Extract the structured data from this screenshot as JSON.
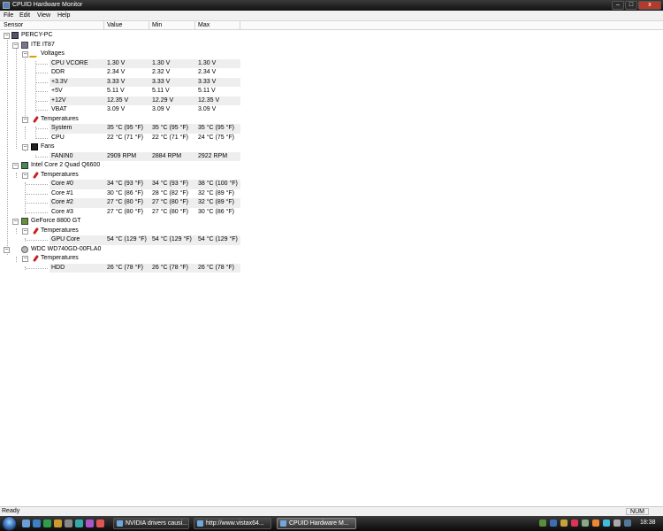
{
  "window": {
    "title": "CPUID Hardware Monitor",
    "min": "–",
    "max": "□",
    "close": "x"
  },
  "menu": [
    "File",
    "Edit",
    "View",
    "Help"
  ],
  "columns": [
    "Sensor",
    "Value",
    "Min",
    "Max"
  ],
  "tree": {
    "root": "PERCY-PC",
    "ite": {
      "name": "ITE IT87",
      "voltages": {
        "label": "Voltages",
        "rows": [
          {
            "name": "CPU VCORE",
            "value": "1.30 V",
            "min": "1.30 V",
            "max": "1.30 V"
          },
          {
            "name": "DDR",
            "value": "2.34 V",
            "min": "2.32 V",
            "max": "2.34 V"
          },
          {
            "name": "+3.3V",
            "value": "3.33 V",
            "min": "3.33 V",
            "max": "3.33 V"
          },
          {
            "name": "+5V",
            "value": "5.11 V",
            "min": "5.11 V",
            "max": "5.11 V"
          },
          {
            "name": "+12V",
            "value": "12.35 V",
            "min": "12.29 V",
            "max": "12.35 V"
          },
          {
            "name": "VBAT",
            "value": "3.09 V",
            "min": "3.09 V",
            "max": "3.09 V"
          }
        ]
      },
      "temperatures": {
        "label": "Temperatures",
        "rows": [
          {
            "name": "System",
            "value": "35 °C  (95 °F)",
            "min": "35 °C  (95 °F)",
            "max": "35 °C  (95 °F)"
          },
          {
            "name": "CPU",
            "value": "22 °C  (71 °F)",
            "min": "22 °C  (71 °F)",
            "max": "24 °C  (75 °F)"
          }
        ]
      },
      "fans": {
        "label": "Fans",
        "rows": [
          {
            "name": "FANIN0",
            "value": "2909 RPM",
            "min": "2884 RPM",
            "max": "2922 RPM"
          }
        ]
      }
    },
    "cpu": {
      "name": "Intel Core 2 Quad Q6600",
      "temperatures": {
        "label": "Temperatures",
        "rows": [
          {
            "name": "Core #0",
            "value": "34 °C  (93 °F)",
            "min": "34 °C  (93 °F)",
            "max": "38 °C  (100 °F)"
          },
          {
            "name": "Core #1",
            "value": "30 °C  (86 °F)",
            "min": "28 °C  (82 °F)",
            "max": "32 °C  (89 °F)"
          },
          {
            "name": "Core #2",
            "value": "27 °C  (80 °F)",
            "min": "27 °C  (80 °F)",
            "max": "32 °C  (89 °F)"
          },
          {
            "name": "Core #3",
            "value": "27 °C  (80 °F)",
            "min": "27 °C  (80 °F)",
            "max": "30 °C  (86 °F)"
          }
        ]
      }
    },
    "gpu": {
      "name": "GeForce 8800 GT",
      "temperatures": {
        "label": "Temperatures",
        "rows": [
          {
            "name": "GPU Core",
            "value": "54 °C  (129 °F)",
            "min": "54 °C  (129 °F)",
            "max": "54 °C  (129 °F)"
          }
        ]
      }
    },
    "hdd": {
      "name": "WDC WD740GD-00FLA0",
      "temperatures": {
        "label": "Temperatures",
        "rows": [
          {
            "name": "HDD",
            "value": "26 °C  (78 °F)",
            "min": "26 °C  (78 °F)",
            "max": "26 °C  (78 °F)"
          }
        ]
      }
    }
  },
  "status": {
    "text": "Ready",
    "num": "NUM"
  },
  "taskbar": {
    "tasks": [
      "NVIDIA drivers causi...",
      "http://www.vistax64...",
      "CPUID Hardware M..."
    ],
    "clock": "18:38"
  }
}
